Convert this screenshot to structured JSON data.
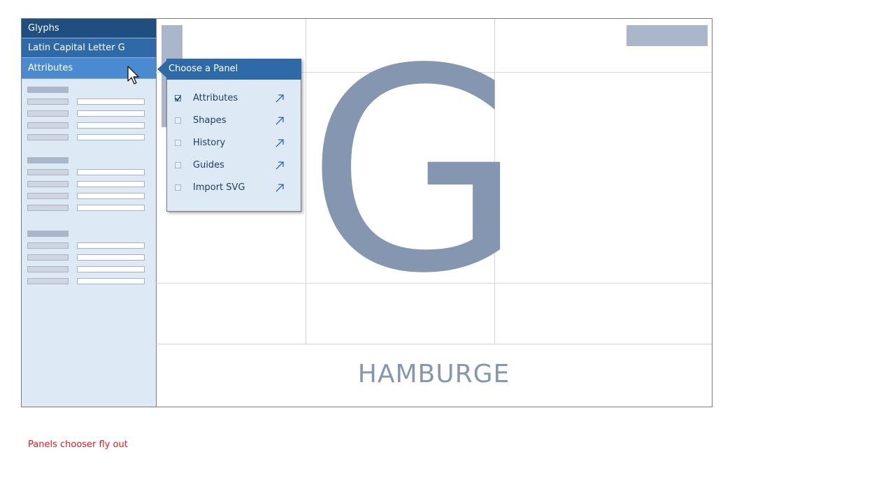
{
  "sidebar": {
    "nav": {
      "glyphs": "Glyphs",
      "letter": "Latin Capital Letter G",
      "attributes": "Attributes"
    }
  },
  "canvas": {
    "glyph": "G",
    "sample_text": "HAMBURGE"
  },
  "panel_chooser": {
    "title": "Choose a Panel",
    "items": [
      {
        "label": "Attributes",
        "checked": true
      },
      {
        "label": "Shapes",
        "checked": false
      },
      {
        "label": "History",
        "checked": false
      },
      {
        "label": "Guides",
        "checked": false
      },
      {
        "label": "Import SVG",
        "checked": false
      }
    ]
  },
  "annotation": {
    "note": "Panels chooser fly out"
  },
  "colors": {
    "nav_dark": "#1f4f80",
    "nav_mid": "#2f6aa8",
    "nav_light": "#4a8ad0",
    "panel_bg": "#dde9f5",
    "glyph": "#8597b0",
    "annotation": "#e3191c"
  }
}
